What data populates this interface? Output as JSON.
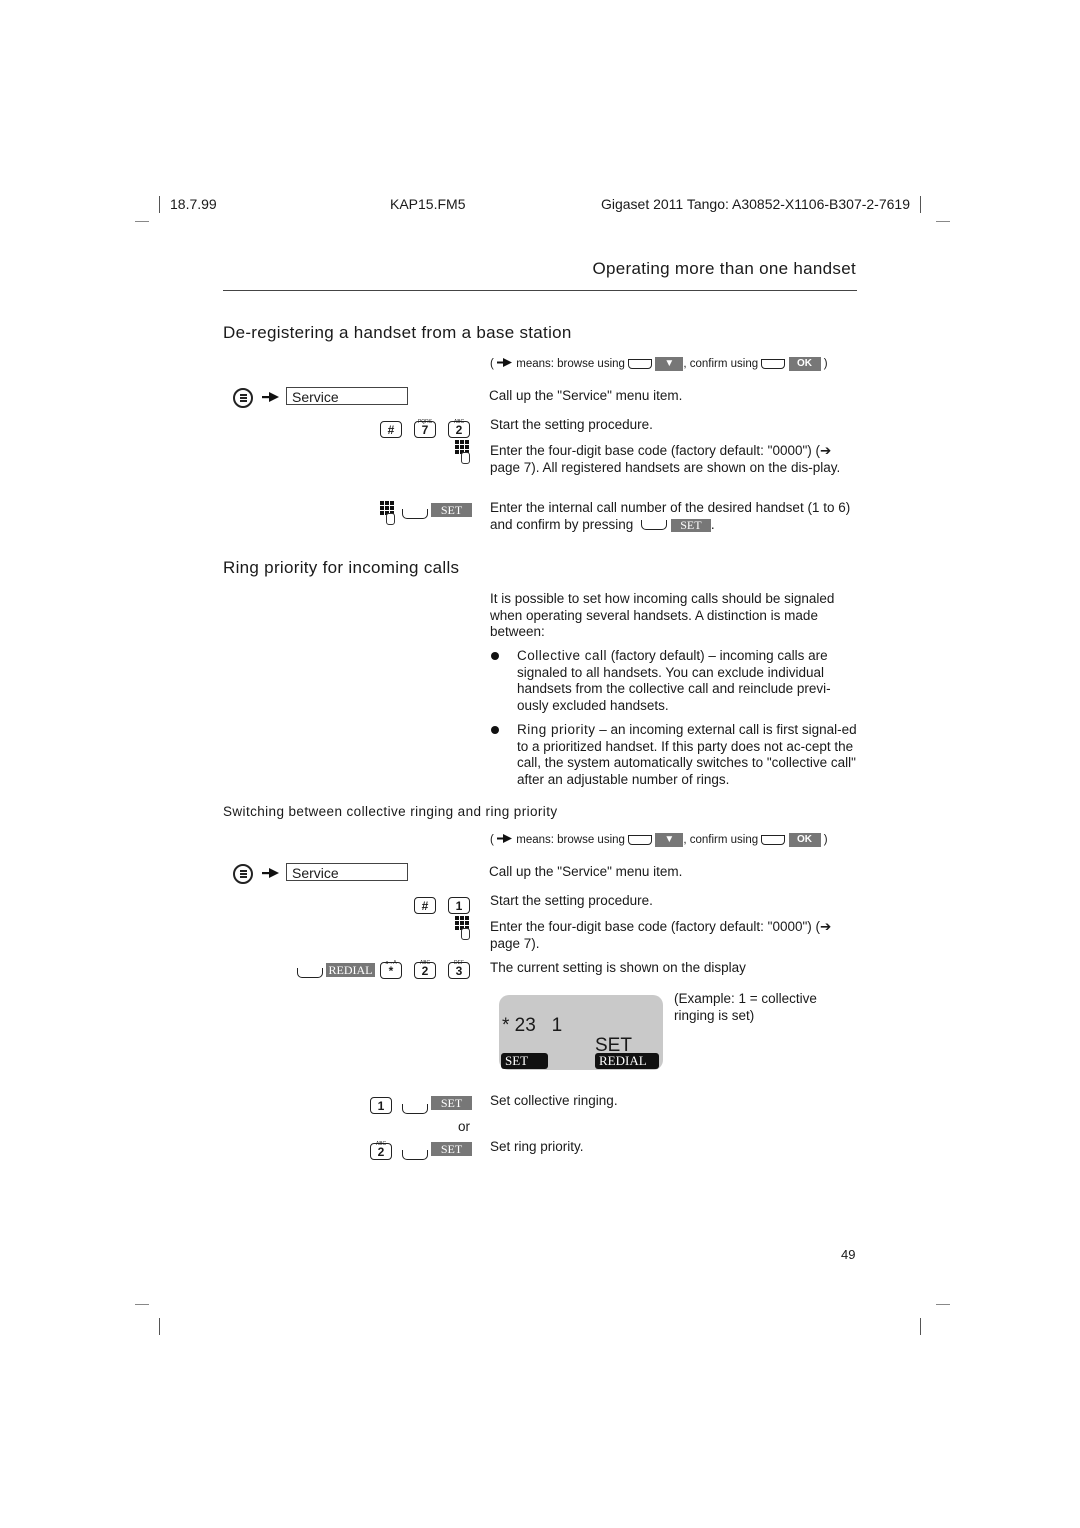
{
  "header": {
    "date": "18.7.99",
    "file": "KAP15.FM5",
    "product": "Gigaset 2011 Tango: A30852-X1106-B307-2-7619"
  },
  "chapter_title": "Operating more than one handset",
  "section1": {
    "title": "De-registering a handset from a base station",
    "legend": {
      "open": "(",
      "text_means": "means: browse using",
      "down_key": "▼",
      "text_confirm": ", confirm using",
      "ok_key": "OK",
      "close": ")"
    },
    "menu_item": "Service",
    "steps": [
      {
        "text": "Call up the \"Service\" menu item."
      },
      {
        "keys": [
          "#",
          "7",
          "2"
        ],
        "key_subs": [
          "",
          "PQRS",
          "ABC"
        ],
        "text": "Start the setting procedure."
      },
      {
        "text": "Enter the four-digit base code (factory default: \"0000\") (➔ page 7). All registered handsets are shown on the dis-play."
      },
      {
        "softkey": "SET",
        "text": "Enter the internal call number of the desired handset (1 to 6) and confirm by pressing",
        "inline_softkey": "SET",
        "text_end": "."
      }
    ]
  },
  "section2": {
    "title": "Ring priority for incoming calls",
    "intro": "It is possible to set how incoming calls should be signaled when operating several handsets. A distinction is made between:",
    "bullets": [
      {
        "term": "Collective call",
        "text": " (factory default) – incoming calls are signaled to all handsets. You can exclude individual handsets from the collective call and reinclude previ-ously excluded handsets."
      },
      {
        "term": "Ring priority",
        "text": " – an incoming external call is first signal-ed to a prioritized handset. If this party does not ac-cept the call, the system automatically switches to \"collective call\" after an adjustable number of rings."
      }
    ]
  },
  "section3": {
    "title": "Switching between collective ringing and ring priority",
    "legend": {
      "open": "(",
      "text_means": "means: browse using",
      "down_key": "▼",
      "text_confirm": ", confirm using",
      "ok_key": "OK",
      "close": ")"
    },
    "menu_item": "Service",
    "steps": [
      {
        "text": "Call up the \"Service\" menu item."
      },
      {
        "keys": [
          "#",
          "1"
        ],
        "text": "Start the setting procedure."
      },
      {
        "text": "Enter the four-digit base code (factory default: \"0000\") (➔ page 7)."
      },
      {
        "softkey": "REDIAL",
        "keys": [
          "*",
          "2",
          "3"
        ],
        "key_subs": [
          "a→A",
          "ABC",
          "DEF"
        ],
        "text": "The current setting is shown on the display"
      }
    ],
    "display": {
      "line1": "* 23   1",
      "line2": "SET",
      "left_tab": "SET",
      "right_tab": "REDIAL"
    },
    "example_note": "(Example: 1 = collective ringing is set)",
    "options": [
      {
        "key": "1",
        "softkey": "SET",
        "text": "Set collective ringing."
      },
      {
        "separator": "or"
      },
      {
        "key": "2",
        "key_sub": "ABC",
        "softkey": "SET",
        "text": "Set ring priority."
      }
    ]
  },
  "page_number": "49",
  "colors": {
    "grey_label": "#777777",
    "lcd_bg": "#c9c9c9",
    "text": "#1a1a1a"
  }
}
